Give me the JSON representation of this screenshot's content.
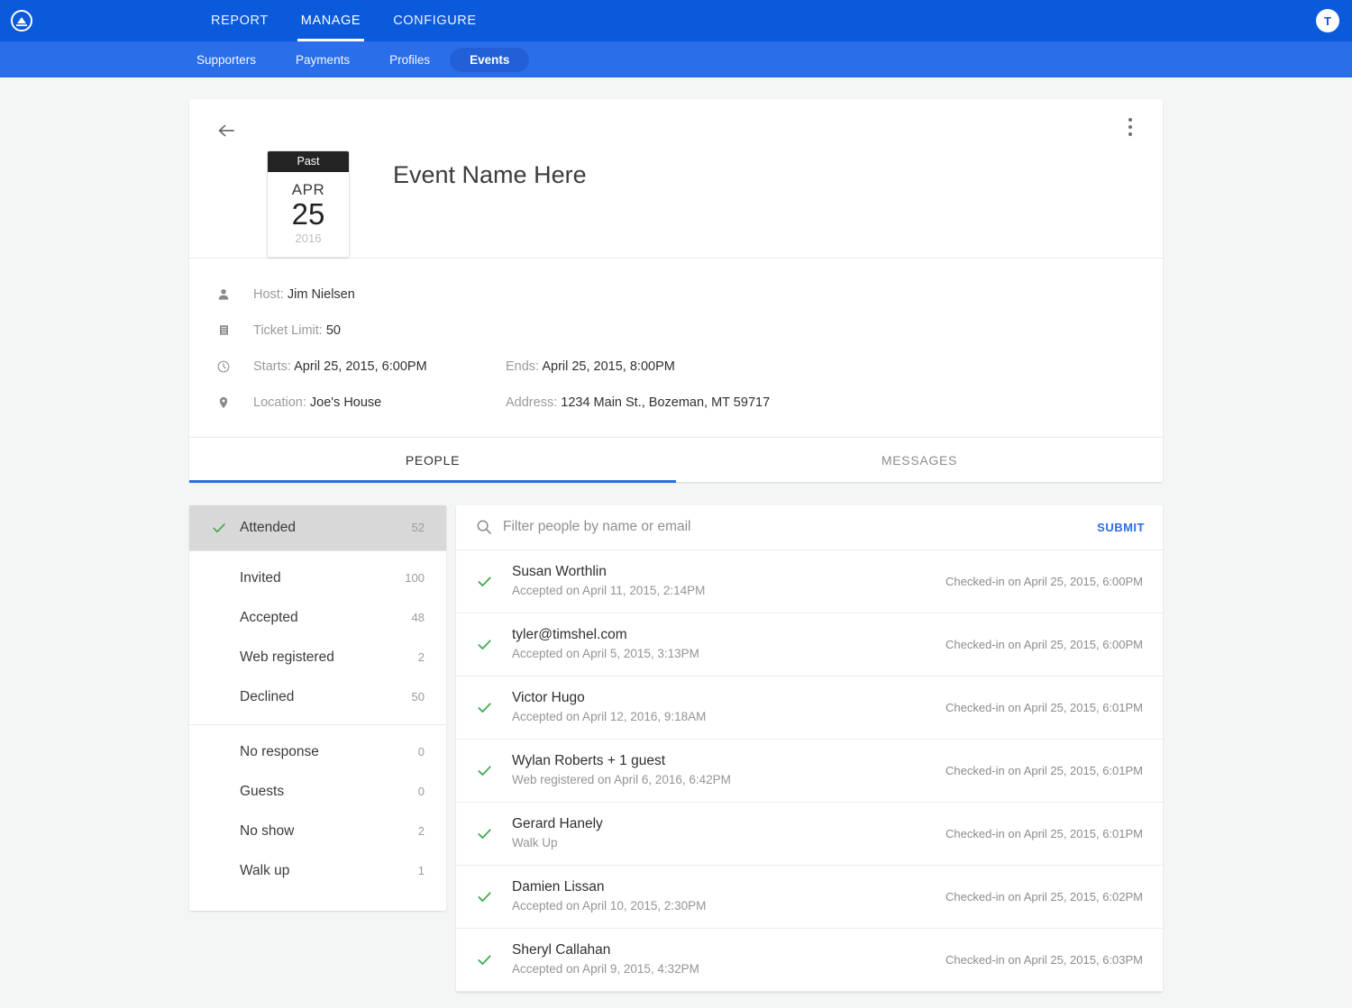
{
  "brand": {
    "primary_blue": "#0a5adb",
    "secondary_blue": "#2b6eea",
    "accent_green": "#3faa4f",
    "logo_icon": "mountain-circle-logo-icon"
  },
  "topnav": {
    "items": [
      {
        "label": "REPORT",
        "active": false
      },
      {
        "label": "MANAGE",
        "active": true
      },
      {
        "label": "CONFIGURE",
        "active": false
      }
    ],
    "avatar_initial": "T"
  },
  "subnav": {
    "items": [
      {
        "label": "Supporters",
        "active": false
      },
      {
        "label": "Payments",
        "active": false
      },
      {
        "label": "Profiles",
        "active": false
      },
      {
        "label": "Events",
        "active": true
      }
    ]
  },
  "event": {
    "back_icon": "back-arrow-icon",
    "menu_icon": "kebab-menu-icon",
    "title": "Event Name Here",
    "calendar": {
      "badge": "Past",
      "month": "APR",
      "day": "25",
      "year": "2016"
    },
    "details": [
      {
        "icon": "person-icon",
        "left_label": "Host:",
        "left_value": "Jim Nielsen",
        "right_label": "",
        "right_value": ""
      },
      {
        "icon": "ticket-icon",
        "left_label": "Ticket Limit:",
        "left_value": "50",
        "right_label": "",
        "right_value": ""
      },
      {
        "icon": "clock-icon",
        "left_label": "Starts:",
        "left_value": "April 25, 2015, 6:00PM",
        "right_label": "Ends:",
        "right_value": "April 25, 2015, 8:00PM"
      },
      {
        "icon": "location-pin-icon",
        "left_label": "Location:",
        "left_value": "Joe's House",
        "right_label": "Address:",
        "right_value": "1234 Main St., Bozeman, MT 59717"
      }
    ],
    "tabs": [
      {
        "label": "PEOPLE",
        "active": true
      },
      {
        "label": "MESSAGES",
        "active": false
      }
    ]
  },
  "filters": {
    "groups": [
      {
        "items": [
          {
            "label": "Attended",
            "count": "52",
            "selected": true,
            "checked": true
          }
        ]
      },
      {
        "items": [
          {
            "label": "Invited",
            "count": "100",
            "selected": false,
            "checked": false
          },
          {
            "label": "Accepted",
            "count": "48",
            "selected": false,
            "checked": false
          },
          {
            "label": "Web registered",
            "count": "2",
            "selected": false,
            "checked": false
          },
          {
            "label": "Declined",
            "count": "50",
            "selected": false,
            "checked": false
          }
        ]
      },
      {
        "items": [
          {
            "label": "No response",
            "count": "0",
            "selected": false,
            "checked": false
          },
          {
            "label": "Guests",
            "count": "0",
            "selected": false,
            "checked": false
          },
          {
            "label": "No show",
            "count": "2",
            "selected": false,
            "checked": false
          },
          {
            "label": "Walk up",
            "count": "1",
            "selected": false,
            "checked": false
          }
        ]
      }
    ]
  },
  "search": {
    "icon": "search-icon",
    "placeholder": "Filter people by name or email",
    "value": "",
    "submit_label": "SUBMIT"
  },
  "people": [
    {
      "name": "Susan Worthlin",
      "sub": "Accepted on April 11, 2015, 2:14PM",
      "status": "Checked-in on April 25, 2015, 6:00PM"
    },
    {
      "name": "tyler@timshel.com",
      "sub": "Accepted on April 5, 2015, 3:13PM",
      "status": "Checked-in on April 25, 2015, 6:00PM"
    },
    {
      "name": "Victor Hugo",
      "sub": "Accepted on April 12, 2016, 9:18AM",
      "status": "Checked-in on April 25, 2015, 6:01PM"
    },
    {
      "name": "Wylan Roberts + 1 guest",
      "sub": "Web registered on April 6, 2016, 6:42PM",
      "status": "Checked-in on April 25, 2015, 6:01PM"
    },
    {
      "name": "Gerard Hanely",
      "sub": "Walk Up",
      "status": "Checked-in on April 25, 2015, 6:01PM"
    },
    {
      "name": "Damien Lissan",
      "sub": "Accepted on April 10, 2015, 2:30PM",
      "status": "Checked-in on April 25, 2015, 6:02PM"
    },
    {
      "name": "Sheryl Callahan",
      "sub": "Accepted on April 9, 2015, 4:32PM",
      "status": "Checked-in on April 25, 2015, 6:03PM"
    }
  ]
}
